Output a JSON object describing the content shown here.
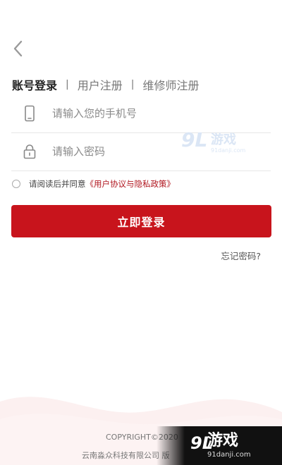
{
  "tabs": [
    {
      "label": "账号登录",
      "active": true
    },
    {
      "label": "用户注册",
      "active": false
    },
    {
      "label": "维修师注册",
      "active": false
    }
  ],
  "tab_separator": "|",
  "phone_field": {
    "placeholder": "请输入您的手机号",
    "value": "",
    "icon": "phone-icon"
  },
  "password_field": {
    "placeholder": "请输入密码",
    "value": "",
    "icon": "lock-icon"
  },
  "agreement": {
    "prefix": "请阅读后并同意",
    "link": "《用户协议与隐私政策》",
    "checked": false
  },
  "login_button": "立即登录",
  "forgot_password": "忘记密码?",
  "footer": {
    "copyright": "COPYRIGHT©2020",
    "company": "云南淼众科技有限公司 版"
  },
  "watermark": {
    "logo": "9L",
    "brand": "游戏",
    "site": "91danji.com"
  },
  "colors": {
    "accent": "#c8141c",
    "link": "#b0151e",
    "wave": "#fbeaea"
  }
}
